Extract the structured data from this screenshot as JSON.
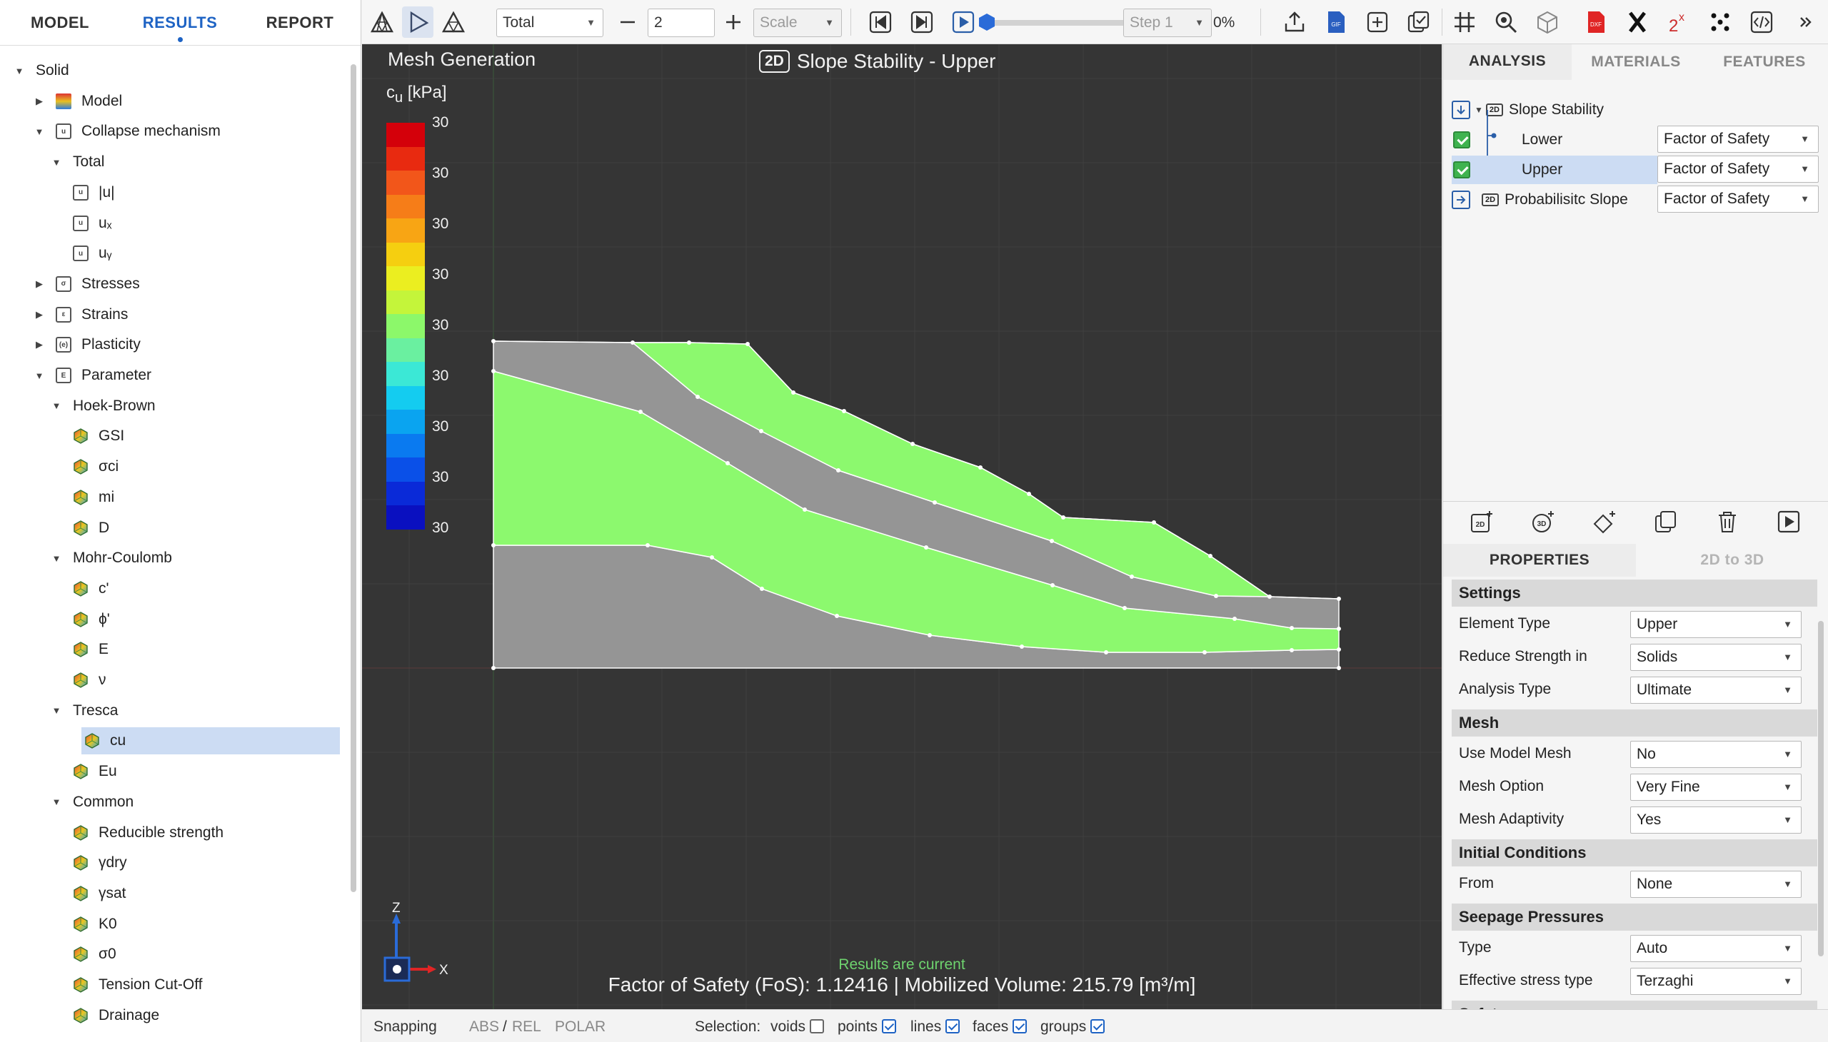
{
  "left_tabs": [
    {
      "label": "MODEL",
      "active": false
    },
    {
      "label": "RESULTS",
      "active": true
    },
    {
      "label": "REPORT",
      "active": false
    }
  ],
  "tree": [
    {
      "label": "Solid",
      "level": 0,
      "caret": "down",
      "icon": "none"
    },
    {
      "label": "Model",
      "level": 1,
      "caret": "right",
      "icon": "colormap"
    },
    {
      "label": "Collapse mechanism",
      "level": 1,
      "caret": "down",
      "icon": "box",
      "glyph": "u"
    },
    {
      "label": "Total",
      "level": 2,
      "caret": "down",
      "icon": "none"
    },
    {
      "label": "|u|",
      "level": 3,
      "caret": "none",
      "icon": "box",
      "glyph": "u"
    },
    {
      "label": "uₓ",
      "level": 3,
      "caret": "none",
      "icon": "box",
      "glyph": "u"
    },
    {
      "label": "uᵧ",
      "level": 3,
      "caret": "none",
      "icon": "box",
      "glyph": "u"
    },
    {
      "label": "Stresses",
      "level": 1,
      "caret": "right",
      "icon": "box",
      "glyph": "σ"
    },
    {
      "label": "Strains",
      "level": 1,
      "caret": "right",
      "icon": "box",
      "glyph": "ε"
    },
    {
      "label": "Plasticity",
      "level": 1,
      "caret": "right",
      "icon": "box",
      "glyph": "(e)"
    },
    {
      "label": "Parameter",
      "level": 1,
      "caret": "down",
      "icon": "box",
      "glyph": "E"
    },
    {
      "label": "Hoek-Brown",
      "level": 2,
      "caret": "down",
      "icon": "none"
    },
    {
      "label": "GSI",
      "level": 3,
      "caret": "none",
      "icon": "hex"
    },
    {
      "label": "σci",
      "level": 3,
      "caret": "none",
      "icon": "hex"
    },
    {
      "label": "mi",
      "level": 3,
      "caret": "none",
      "icon": "hex"
    },
    {
      "label": "D",
      "level": 3,
      "caret": "none",
      "icon": "hex"
    },
    {
      "label": "Mohr-Coulomb",
      "level": 2,
      "caret": "down",
      "icon": "none"
    },
    {
      "label": "c'",
      "level": 3,
      "caret": "none",
      "icon": "hex"
    },
    {
      "label": "ϕ'",
      "level": 3,
      "caret": "none",
      "icon": "hex"
    },
    {
      "label": "E",
      "level": 3,
      "caret": "none",
      "icon": "hex"
    },
    {
      "label": "ν",
      "level": 3,
      "caret": "none",
      "icon": "hex"
    },
    {
      "label": "Tresca",
      "level": 2,
      "caret": "down",
      "icon": "none"
    },
    {
      "label": "cu",
      "level": 3,
      "caret": "none",
      "icon": "hex",
      "selected": true
    },
    {
      "label": "Eu",
      "level": 3,
      "caret": "none",
      "icon": "hex"
    },
    {
      "label": "Common",
      "level": 2,
      "caret": "down",
      "icon": "none"
    },
    {
      "label": "Reducible strength",
      "level": 3,
      "caret": "none",
      "icon": "hex"
    },
    {
      "label": "γdry",
      "level": 3,
      "caret": "none",
      "icon": "hex"
    },
    {
      "label": "γsat",
      "level": 3,
      "caret": "none",
      "icon": "hex"
    },
    {
      "label": "K0",
      "level": 3,
      "caret": "none",
      "icon": "hex"
    },
    {
      "label": "σ0",
      "level": 3,
      "caret": "none",
      "icon": "hex"
    },
    {
      "label": "Tension Cut-Off",
      "level": 3,
      "caret": "none",
      "icon": "hex"
    },
    {
      "label": "Drainage",
      "level": 3,
      "caret": "none",
      "icon": "hex"
    }
  ],
  "toolbar": {
    "component_select": "Total",
    "step_value": "2",
    "scale_placeholder": "Scale",
    "step_select": "Step 1",
    "progress_label": "0%",
    "progress": 0
  },
  "viewport": {
    "title": "Mesh Generation",
    "header_badge": "2D",
    "header_title": "Slope Stability  - Upper",
    "legend_symbol": "cu",
    "legend_sub": "u",
    "legend_unit": "[kPa]",
    "legend_labels": [
      "30",
      "30",
      "30",
      "30",
      "30",
      "30",
      "30",
      "30",
      "30"
    ],
    "legend_colors": [
      "#d4000a",
      "#e82a10",
      "#f2561a",
      "#f67d18",
      "#f8a514",
      "#f5cf10",
      "#ebee20",
      "#c4f53a",
      "#8cf86a",
      "#6af0a0",
      "#3be8d6",
      "#14ccf0",
      "#0aa4f0",
      "#0a7af0",
      "#0a50e8",
      "#0a2ad8",
      "#0a10c0"
    ],
    "status_current": "Results are current",
    "status_fos": "Factor of Safety (FoS): 1.12416 | Mobilized Volume: 215.79 [m³/m]",
    "colors": {
      "green_zone": "#8cf96e",
      "grey_zone": "#959595",
      "background": "#353535"
    }
  },
  "bottom": {
    "snapping": "Snapping",
    "abs": "ABS",
    "slash": "/",
    "rel": "REL",
    "polar": "POLAR",
    "selection_label": "Selection:",
    "voids": "voids",
    "points": "points",
    "lines": "lines",
    "faces": "faces",
    "groups": "groups",
    "checks": {
      "voids": false,
      "points": true,
      "lines": true,
      "faces": true,
      "groups": true
    }
  },
  "right_tabs": [
    {
      "label": "ANALYSIS",
      "active": true
    },
    {
      "label": "MATERIALS",
      "active": false
    },
    {
      "label": "FEATURES",
      "active": false
    }
  ],
  "analysis": {
    "root_badge": "2D",
    "root_label": "Slope Stability",
    "lower_label": "Lower",
    "lower_value": "Factor of Safety",
    "upper_label": "Upper",
    "upper_value": "Factor of Safety",
    "prob_badge": "2D",
    "prob_label": "Probabilisitc Slope",
    "prob_value": "Factor of Safety"
  },
  "prop_tabs": [
    {
      "label": "PROPERTIES",
      "active": true
    },
    {
      "label": "2D to 3D",
      "active": false
    }
  ],
  "properties": {
    "settings_title": "Settings",
    "element_type_label": "Element Type",
    "element_type_value": "Upper",
    "reduce_label": "Reduce Strength in",
    "reduce_value": "Solids",
    "analysis_type_label": "Analysis Type",
    "analysis_type_value": "Ultimate",
    "mesh_title": "Mesh",
    "use_mesh_label": "Use Model Mesh",
    "use_mesh_value": "No",
    "mesh_option_label": "Mesh Option",
    "mesh_option_value": "Very Fine",
    "adaptivity_label": "Mesh Adaptivity",
    "adaptivity_value": "Yes",
    "initial_title": "Initial Conditions",
    "from_label": "From",
    "from_value": "None",
    "seepage_title": "Seepage Pressures",
    "type_label": "Type",
    "type_value": "Auto",
    "eff_label": "Effective stress type",
    "eff_value": "Terzaghi",
    "safety_title": "Safety"
  }
}
